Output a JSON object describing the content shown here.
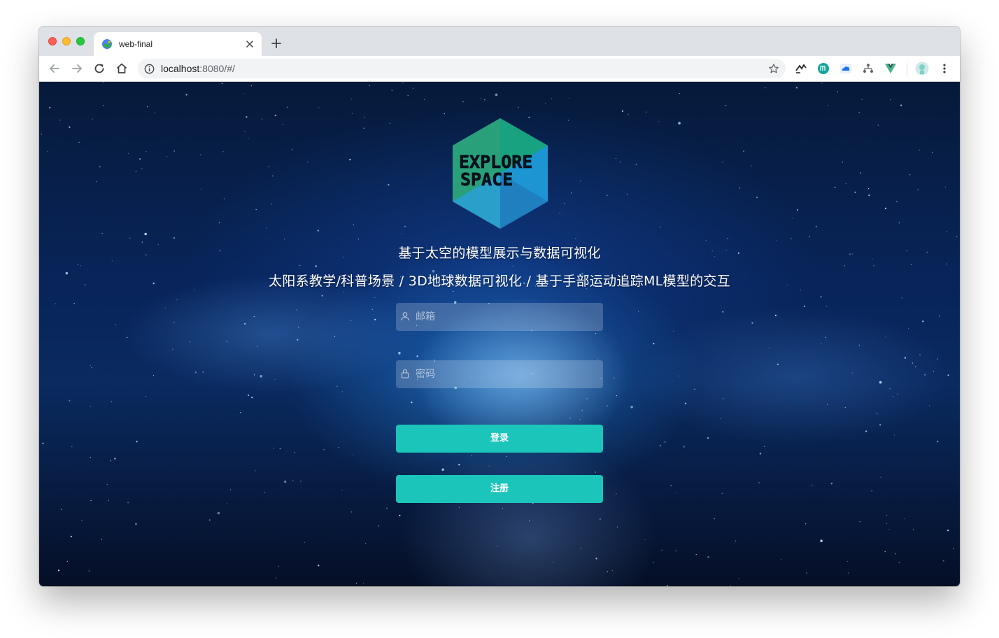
{
  "browser": {
    "tab_title": "web-final",
    "url_host": "localhost",
    "url_path": ":8080/#/"
  },
  "page": {
    "logo_line1": "EXPLORE",
    "logo_line2": "SPACE",
    "subtitle1": "基于太空的模型展示与数据可视化",
    "subtitle2": "太阳系教学/科普场景 / 3D地球数据可视化 / 基于手部运动追踪ML模型的交互",
    "email_placeholder": "邮箱",
    "password_placeholder": "密码",
    "login_label": "登录",
    "register_label": "注册"
  },
  "colors": {
    "accent": "#1bc5b9",
    "logo_hex_green": "#2aa07a",
    "logo_hex_blue": "#1b8ec9"
  },
  "icons": [
    "favicon-icon",
    "close-icon",
    "plus-icon",
    "back-icon",
    "forward-icon",
    "reload-icon",
    "home-icon",
    "info-icon",
    "star-icon",
    "extension-icon",
    "profile-icon",
    "menu-icon",
    "user-icon",
    "lock-icon"
  ]
}
